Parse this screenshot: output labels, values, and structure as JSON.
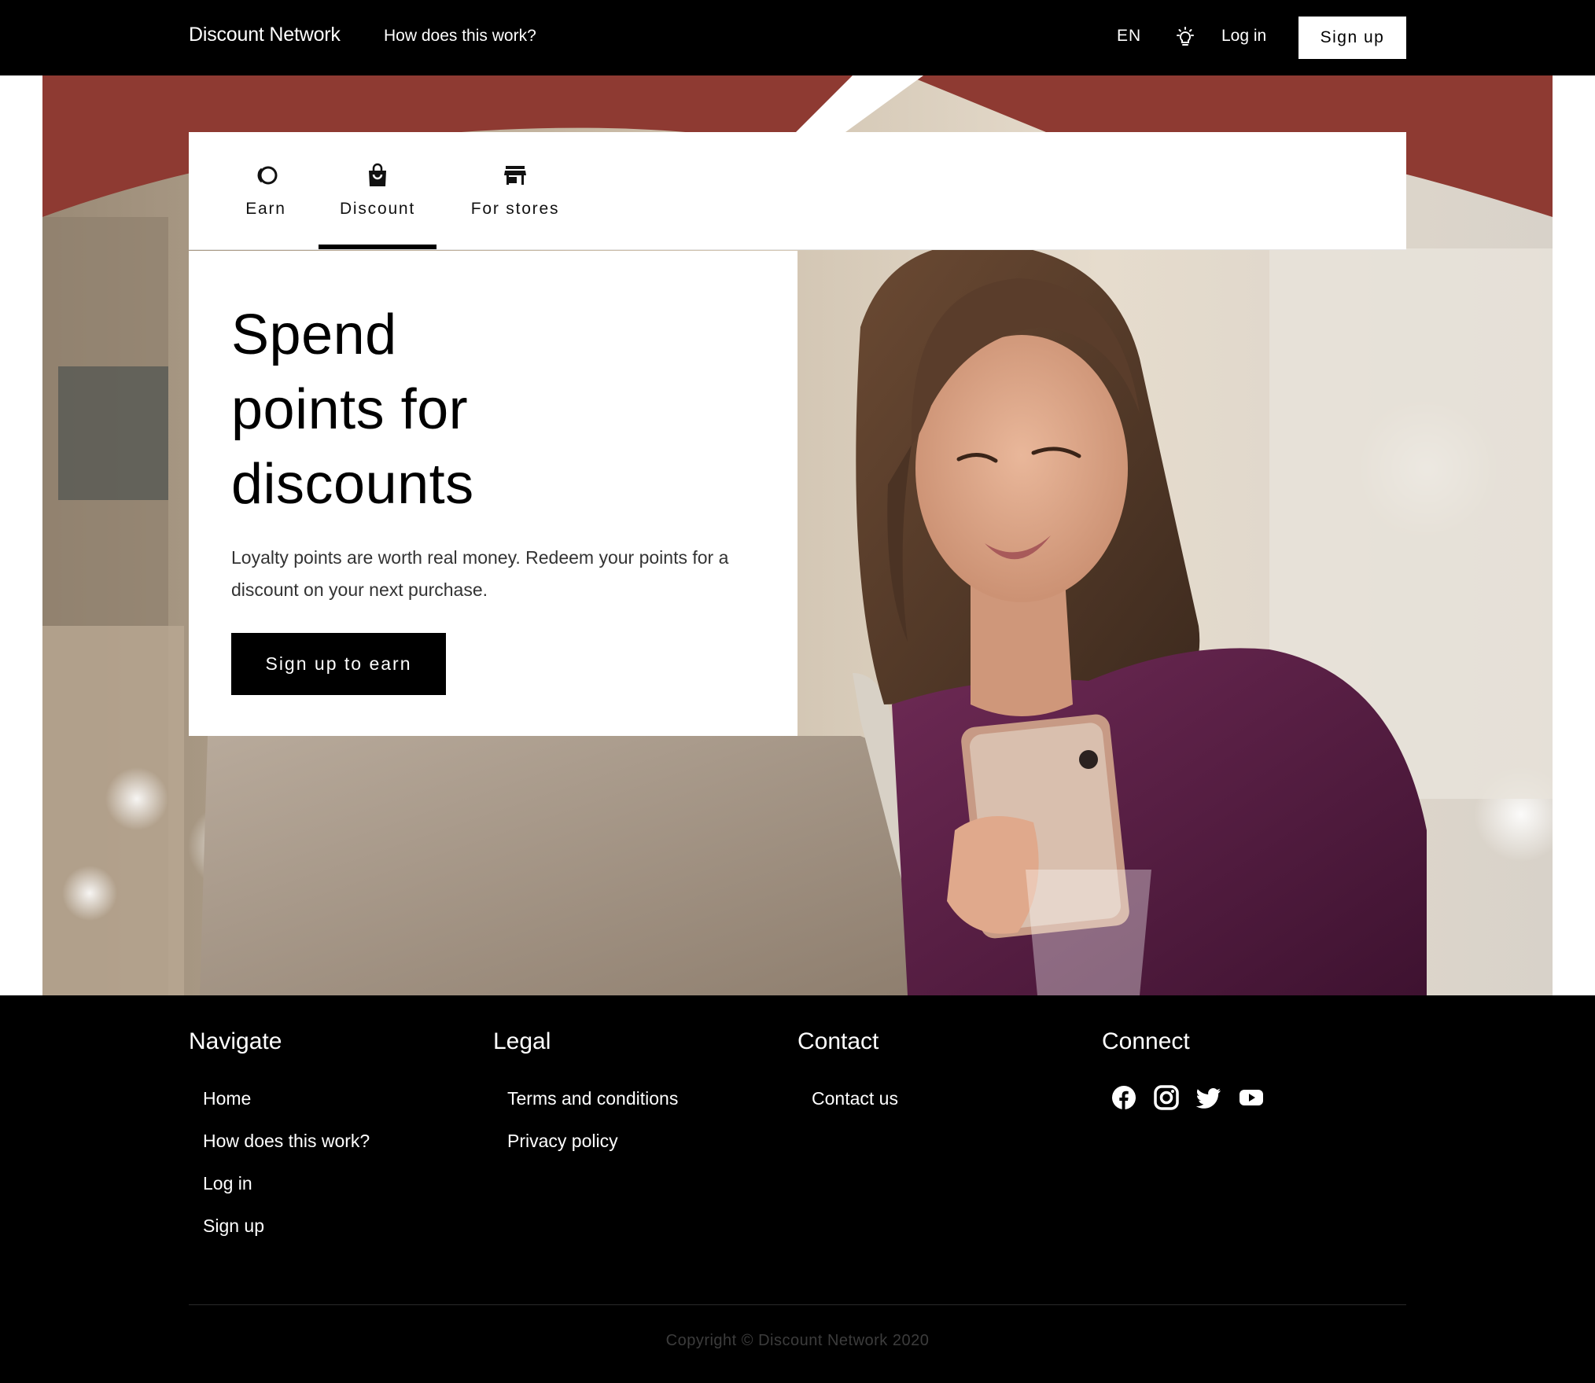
{
  "header": {
    "brand": "Discount Network",
    "how_link": "How does this work?",
    "language": "EN",
    "login": "Log in",
    "signup": "Sign up",
    "theme_icon": "lightbulb-icon"
  },
  "tabs": [
    {
      "label": "Earn",
      "icon": "coins-icon"
    },
    {
      "label": "Discount",
      "icon": "shopping-bag-icon",
      "active": true
    },
    {
      "label": "For stores",
      "icon": "storefront-icon"
    }
  ],
  "hero": {
    "headline_line1": "Spend",
    "headline_line2": "points for",
    "headline_line3": "discounts",
    "lead": "Loyalty points are worth real money. Redeem your points for a discount on your next purchase.",
    "cta": "Sign up to earn"
  },
  "footer": {
    "navigate": {
      "title": "Navigate",
      "items": [
        "Home",
        "How does this work?",
        "Log in",
        "Sign up"
      ]
    },
    "legal": {
      "title": "Legal",
      "items": [
        "Terms and conditions",
        "Privacy policy"
      ]
    },
    "contact": {
      "title": "Contact",
      "items": [
        "Contact us"
      ]
    },
    "connect": {
      "title": "Connect",
      "icons": [
        "facebook-icon",
        "instagram-icon",
        "twitter-icon",
        "youtube-icon"
      ]
    },
    "copyright": "Copyright © Discount Network 2020"
  },
  "colors": {
    "header_bg": "#000000",
    "footer_bg": "#000000",
    "accent": "#000000",
    "dress": "#5a1f45"
  }
}
